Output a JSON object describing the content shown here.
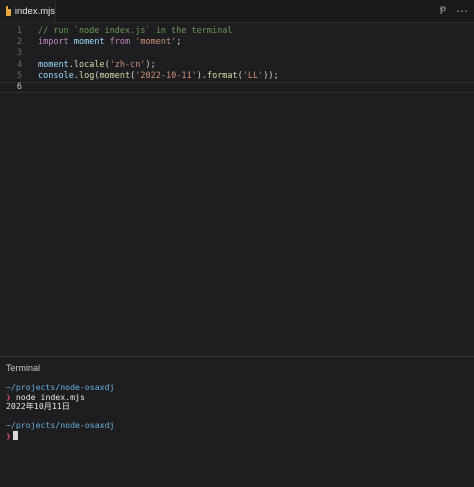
{
  "tab": {
    "label": "index.mjs"
  },
  "editor": {
    "lines": [
      {
        "n": "1",
        "tokens": [
          {
            "t": "// run `node index.js` in the terminal",
            "c": "comment"
          }
        ]
      },
      {
        "n": "2",
        "tokens": [
          {
            "t": "import ",
            "c": "kw"
          },
          {
            "t": "moment ",
            "c": "id"
          },
          {
            "t": "from ",
            "c": "kw"
          },
          {
            "t": "'moment'",
            "c": "str"
          },
          {
            "t": ";",
            "c": "punc"
          }
        ]
      },
      {
        "n": "3",
        "tokens": []
      },
      {
        "n": "4",
        "tokens": [
          {
            "t": "moment",
            "c": "id"
          },
          {
            "t": ".",
            "c": "punc"
          },
          {
            "t": "locale",
            "c": "fn"
          },
          {
            "t": "(",
            "c": "punc"
          },
          {
            "t": "'zh-cn'",
            "c": "str"
          },
          {
            "t": ");",
            "c": "punc"
          }
        ]
      },
      {
        "n": "5",
        "tokens": [
          {
            "t": "console",
            "c": "id"
          },
          {
            "t": ".",
            "c": "punc"
          },
          {
            "t": "log",
            "c": "fn"
          },
          {
            "t": "(",
            "c": "punc"
          },
          {
            "t": "moment",
            "c": "fn"
          },
          {
            "t": "(",
            "c": "punc"
          },
          {
            "t": "'2022-10-11'",
            "c": "str"
          },
          {
            "t": ").",
            "c": "punc"
          },
          {
            "t": "format",
            "c": "fn"
          },
          {
            "t": "(",
            "c": "punc"
          },
          {
            "t": "'LL'",
            "c": "str"
          },
          {
            "t": "));",
            "c": "punc"
          }
        ]
      },
      {
        "n": "6",
        "tokens": []
      }
    ],
    "active_line": "6"
  },
  "terminal": {
    "title": "Terminal",
    "lines": [
      {
        "kind": "path",
        "text": "~/projects/node-osaxdj"
      },
      {
        "kind": "cmd",
        "arrow": "❯",
        "text": " node index.mjs"
      },
      {
        "kind": "out",
        "text": "2022年10月11日"
      },
      {
        "kind": "blank",
        "text": ""
      },
      {
        "kind": "path",
        "text": "~/projects/node-osaxdj"
      },
      {
        "kind": "prompt",
        "arrow": "❯",
        "text": ""
      }
    ]
  },
  "icons": {
    "file": "js-file-icon",
    "preview": "preview-icon",
    "more": "more-icon"
  },
  "colors": {
    "background": "#1e1e20",
    "path": "#6aaedc",
    "prompt": "#e0507a"
  }
}
